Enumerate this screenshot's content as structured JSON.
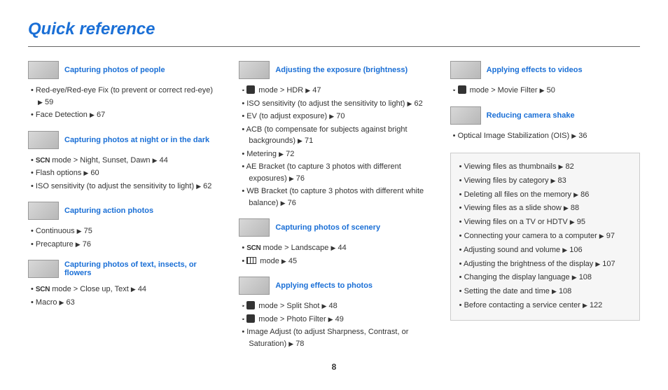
{
  "title": "Quick reference",
  "page_number": "8",
  "col1": [
    {
      "heading": "Capturing photos of people",
      "items": [
        {
          "text": "Red-eye/Red-eye Fix (to prevent or correct red-eye)",
          "page": "59"
        },
        {
          "text": "Face Detection",
          "page": "67"
        }
      ]
    },
    {
      "heading": "Capturing photos at night or in the dark",
      "items": [
        {
          "prefix": "scn",
          "text": " mode > Night, Sunset, Dawn",
          "page": "44"
        },
        {
          "text": "Flash options",
          "page": "60"
        },
        {
          "text": "ISO sensitivity (to adjust the sensitivity to light)",
          "page": "62"
        }
      ]
    },
    {
      "heading": "Capturing action photos",
      "items": [
        {
          "text": "Continuous",
          "page": "75"
        },
        {
          "text": "Precapture",
          "page": "76"
        }
      ]
    },
    {
      "heading": "Capturing photos of text, insects, or flowers",
      "items": [
        {
          "prefix": "scn",
          "text": " mode > Close up, Text",
          "page": "44"
        },
        {
          "text": "Macro",
          "page": "63"
        }
      ]
    }
  ],
  "col2": [
    {
      "heading": "Adjusting the exposure (brightness)",
      "items": [
        {
          "prefix": "mode",
          "text": " mode > HDR",
          "page": "47"
        },
        {
          "text": "ISO sensitivity (to adjust the sensitivity to light)",
          "page": "62"
        },
        {
          "text": "EV (to adjust exposure)",
          "page": "70"
        },
        {
          "text": "ACB (to compensate for subjects against bright backgrounds)",
          "page": "71"
        },
        {
          "text": "Metering",
          "page": "72"
        },
        {
          "text": "AE Bracket (to capture 3 photos with different exposures)",
          "page": "76"
        },
        {
          "text": "WB Bracket (to capture 3 photos with different white balance)",
          "page": "76"
        }
      ]
    },
    {
      "heading": "Capturing photos of scenery",
      "items": [
        {
          "prefix": "scn",
          "text": " mode > Landscape",
          "page": "44"
        },
        {
          "prefix": "pan",
          "text": " mode",
          "page": "45"
        }
      ]
    },
    {
      "heading": "Applying effects to photos",
      "items": [
        {
          "prefix": "mode",
          "text": " mode > Split Shot",
          "page": "48"
        },
        {
          "prefix": "mode",
          "text": " mode > Photo Filter",
          "page": "49"
        },
        {
          "text": "Image Adjust (to adjust Sharpness, Contrast, or Saturation)",
          "page": "78"
        }
      ]
    }
  ],
  "col3": [
    {
      "heading": "Applying effects to videos",
      "items": [
        {
          "prefix": "mode",
          "text": " mode > Movie Filter",
          "page": "50"
        }
      ]
    },
    {
      "heading": "Reducing camera shake",
      "items": [
        {
          "text": "Optical Image Stabilization (OIS)",
          "page": "36"
        }
      ]
    }
  ],
  "box": [
    {
      "text": "Viewing files as thumbnails",
      "page": "82"
    },
    {
      "text": "Viewing files by category",
      "page": "83"
    },
    {
      "text": "Deleting all files on the memory",
      "page": "86"
    },
    {
      "text": "Viewing files as a slide show",
      "page": "88"
    },
    {
      "text": "Viewing files on a TV or HDTV",
      "page": "95"
    },
    {
      "text": "Connecting your camera to a computer",
      "page": "97"
    },
    {
      "text": "Adjusting sound and volume",
      "page": "106"
    },
    {
      "text": "Adjusting the brightness of the display",
      "page": "107"
    },
    {
      "text": "Changing the display language",
      "page": "108"
    },
    {
      "text": "Setting the date and time",
      "page": "108"
    },
    {
      "text": "Before contacting a service center",
      "page": "122"
    }
  ]
}
